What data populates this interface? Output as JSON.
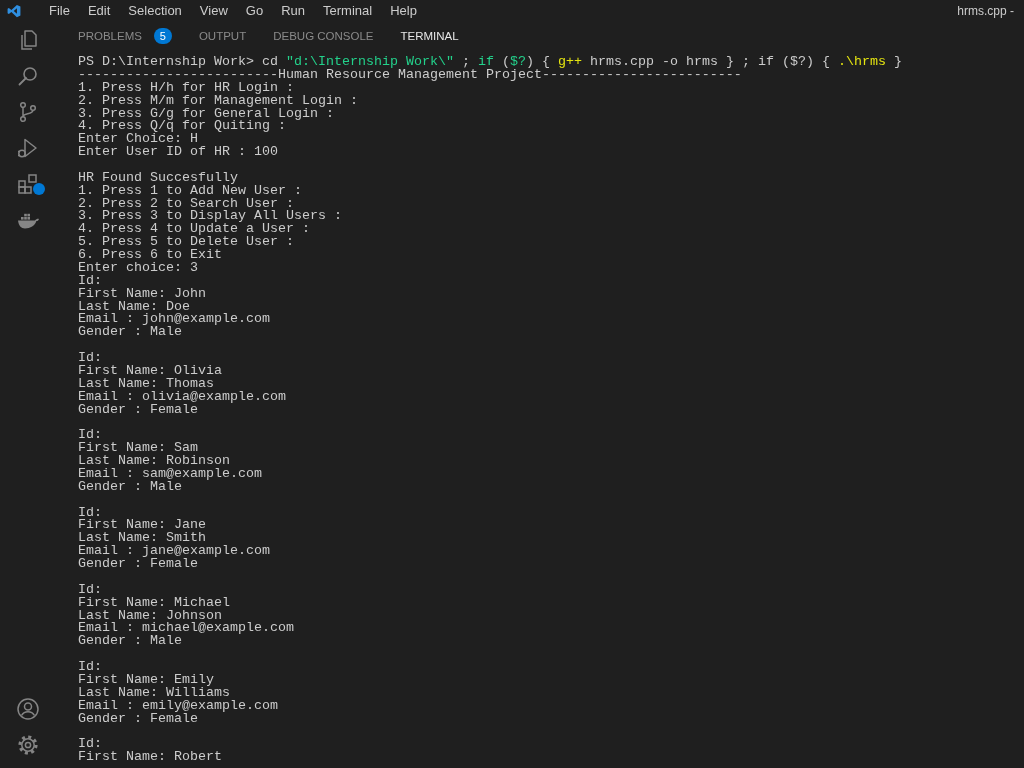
{
  "menu_bar": {
    "items": [
      "File",
      "Edit",
      "Selection",
      "View",
      "Go",
      "Run",
      "Terminal",
      "Help"
    ],
    "title": "hrms.cpp -"
  },
  "panel": {
    "tabs": [
      {
        "label": "PROBLEMS",
        "selected": false,
        "count": "5"
      },
      {
        "label": "OUTPUT",
        "selected": false
      },
      {
        "label": "DEBUG CONSOLE",
        "selected": false
      },
      {
        "label": "TERMINAL",
        "selected": true
      }
    ]
  },
  "terminal": {
    "command": [
      {
        "kind": "prompt",
        "text": "PS D:\\Internship Work> "
      },
      {
        "kind": "plain",
        "text": "cd "
      },
      {
        "kind": "string",
        "text": "\"d:\\Internship Work\\\""
      },
      {
        "kind": "plain",
        "text": " ; "
      },
      {
        "kind": "keyword",
        "text": "if"
      },
      {
        "kind": "plain",
        "text": " ("
      },
      {
        "kind": "variable",
        "text": "$?"
      },
      {
        "kind": "plain",
        "text": ") { "
      },
      {
        "kind": "command",
        "text": "g++"
      },
      {
        "kind": "plain",
        "text": " hrms.cpp -o hrms } ; if ($?) { "
      },
      {
        "kind": "command",
        "text": ".\\hrms"
      },
      {
        "kind": "plain",
        "text": " }"
      }
    ],
    "output_blocks": [
      {
        "lines": [
          "-------------------------Human Resource Management Project-------------------------",
          "1. Press H/h for HR Login :",
          "2. Press M/m for Management Login :",
          "3. Press G/g for General Login :",
          "4. Press Q/q for Quiting :",
          "Enter Choice: H",
          "Enter User ID of HR : 100"
        ]
      },
      {
        "lines": [
          "HR Found Succesfully",
          "1. Press 1 to Add New User :",
          "2. Press 2 to Search User :",
          "3. Press 3 to Display All Users :",
          "4. Press 4 to Update a User :",
          "5. Press 5 to Delete User :",
          "6. Press 6 to Exit",
          "Enter choice: 3",
          "Id:",
          "First Name: John",
          "Last Name: Doe",
          "Email : john@example.com",
          "Gender : Male"
        ]
      },
      {
        "lines": [
          "Id:",
          "First Name: Olivia",
          "Last Name: Thomas",
          "Email : olivia@example.com",
          "Gender : Female"
        ]
      },
      {
        "lines": [
          "Id:",
          "First Name: Sam",
          "Last Name: Robinson",
          "Email : sam@example.com",
          "Gender : Male"
        ]
      },
      {
        "lines": [
          "Id:",
          "First Name: Jane",
          "Last Name: Smith",
          "Email : jane@example.com",
          "Gender : Female"
        ]
      },
      {
        "lines": [
          "Id:",
          "First Name: Michael",
          "Last Name: Johnson",
          "Email : michael@example.com",
          "Gender : Male"
        ]
      },
      {
        "lines": [
          "Id:",
          "First Name: Emily",
          "Last Name: Williams",
          "Email : emily@example.com",
          "Gender : Female"
        ]
      },
      {
        "lines": [
          "Id:",
          "First Name: Robert"
        ]
      }
    ]
  }
}
